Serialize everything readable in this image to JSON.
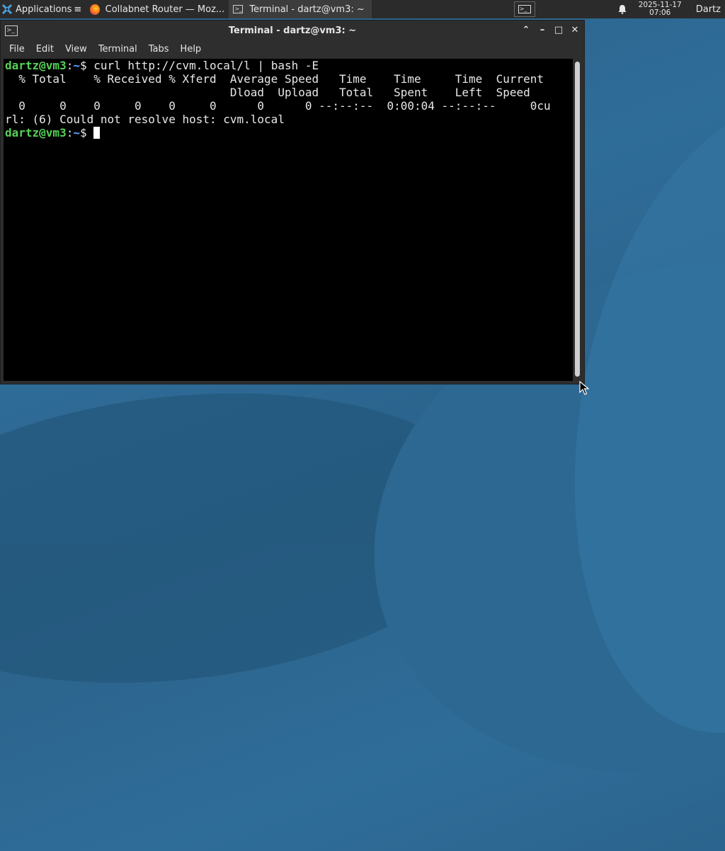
{
  "panel": {
    "applications_label": "Applications",
    "tasks": [
      {
        "label": "Collabnet Router — Moz..."
      },
      {
        "label": "Terminal - dartz@vm3: ~"
      }
    ],
    "clock": {
      "date": "2025-11-17",
      "time": "07:06"
    },
    "user": "Dartz"
  },
  "window": {
    "title": "Terminal - dartz@vm3: ~",
    "menu": [
      "File",
      "Edit",
      "View",
      "Terminal",
      "Tabs",
      "Help"
    ]
  },
  "terminal": {
    "prompt_user": "dartz@vm3",
    "prompt_sep": ":",
    "prompt_path": "~",
    "prompt_symbol": "$ ",
    "command": "curl http://cvm.local/l | bash -E",
    "output": [
      "  % Total    % Received % Xferd  Average Speed   Time    Time     Time  Current",
      "                                 Dload  Upload   Total   Spent    Left  Speed",
      "  0     0    0     0    0     0      0      0 --:--:--  0:00:04 --:--:--     0cu",
      "rl: (6) Could not resolve host: cvm.local"
    ]
  },
  "colors": {
    "prompt_user": "#55d255",
    "prompt_path": "#5fa8ff",
    "terminal_bg": "#000000",
    "panel_bg": "#2b2b2b"
  }
}
